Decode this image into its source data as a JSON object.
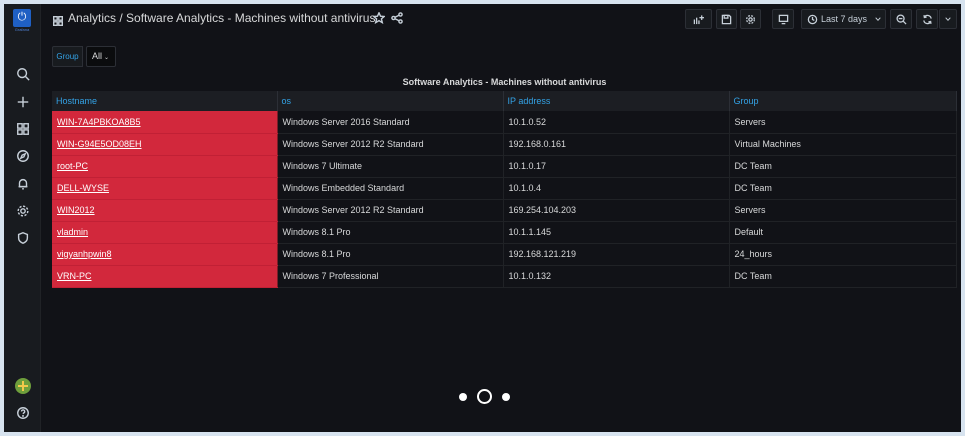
{
  "sidebar": {
    "logo_caption": "Grafana",
    "items": [
      "search",
      "create",
      "dashboards",
      "explore",
      "alerting",
      "configuration",
      "shield"
    ]
  },
  "header": {
    "title": "Analytics / Software Analytics - Machines without antivirus",
    "time_range": "Last 7 days"
  },
  "variables": {
    "group_label": "Group",
    "group_value": "All"
  },
  "panel": {
    "title": "Software Analytics - Machines without antivirus",
    "columns": [
      "Hostname",
      "os",
      "IP address",
      "Group"
    ],
    "rows": [
      [
        "WIN-7A4PBKOA8B5",
        "Windows Server 2016 Standard",
        "10.1.0.52",
        "Servers"
      ],
      [
        "WIN-G94E5OD08EH",
        "Windows Server 2012 R2 Standard",
        "192.168.0.161",
        "Virtual Machines"
      ],
      [
        "root-PC",
        "Windows 7 Ultimate",
        "10.1.0.17",
        "DC Team"
      ],
      [
        "DELL-WYSE",
        "Windows Embedded Standard",
        "10.1.0.4",
        "DC Team"
      ],
      [
        "WIN2012",
        "Windows Server 2012 R2 Standard",
        "169.254.104.203",
        "Servers"
      ],
      [
        "vladmin",
        "Windows 8.1 Pro",
        "10.1.1.145",
        "Default"
      ],
      [
        "vigyanhpwin8",
        "Windows 8.1 Pro",
        "192.168.121.219",
        "24_hours"
      ],
      [
        "VRN-PC",
        "Windows 7 Professional",
        "10.1.0.132",
        "DC Team"
      ]
    ]
  },
  "colors": {
    "hostname_cell": "#d2283c",
    "header_link": "#33a2e5",
    "background": "#111217"
  }
}
